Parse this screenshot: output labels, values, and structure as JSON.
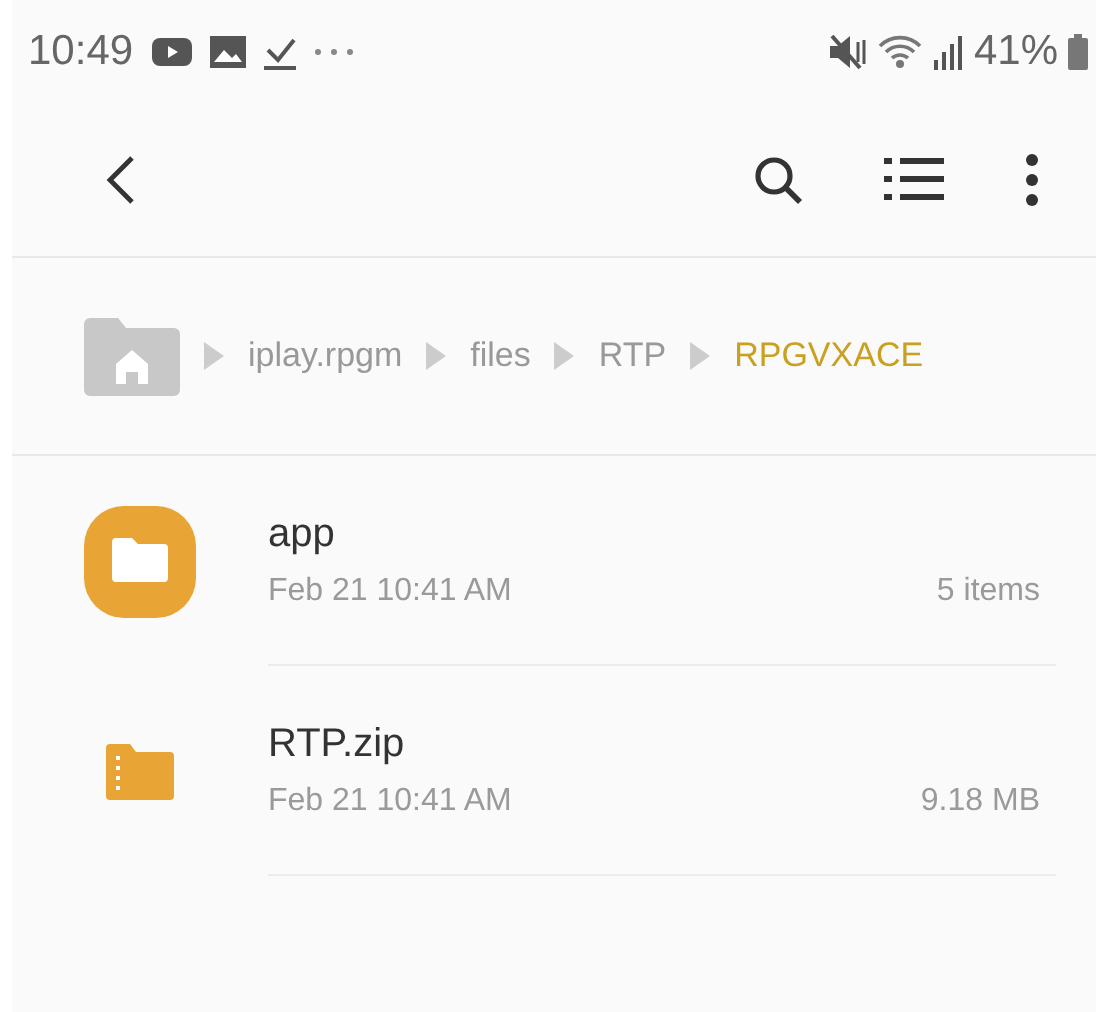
{
  "status_bar": {
    "time": "10:49",
    "battery": "41%"
  },
  "breadcrumb": [
    {
      "label": "iplay.rpgm",
      "selected": false
    },
    {
      "label": "files",
      "selected": false
    },
    {
      "label": "RTP",
      "selected": false
    },
    {
      "label": "RPGVXACE",
      "selected": true
    }
  ],
  "files": [
    {
      "kind": "folder",
      "name": "app",
      "date": "Feb 21 10:41 AM",
      "info": "5 items"
    },
    {
      "kind": "archive",
      "name": "RTP.zip",
      "date": "Feb 21 10:41 AM",
      "info": "9.18 MB"
    }
  ]
}
